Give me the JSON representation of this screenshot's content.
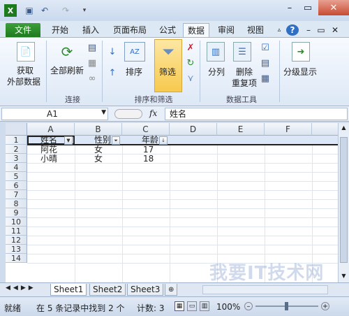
{
  "quick_access": {
    "icons": [
      "excel-icon",
      "save-icon",
      "undo-icon",
      "redo-icon"
    ]
  },
  "menu": {
    "file": "文件",
    "home": "开始",
    "insert": "插入",
    "page_layout": "页面布局",
    "formulas": "公式",
    "data": "数据",
    "review": "审阅",
    "view": "视图"
  },
  "ribbon": {
    "get_external_line1": "获取",
    "get_external_line2": "外部数据",
    "refresh_all": "全部刷新",
    "connections_group": "连接",
    "sort": "排序",
    "filter": "筛选",
    "sort_filter_group": "排序和筛选",
    "text_to_columns": "分列",
    "remove_dup_line1": "删除",
    "remove_dup_line2": "重复项",
    "data_tools_group": "数据工具",
    "outline": "分级显示"
  },
  "formula_bar": {
    "name_box": "A1",
    "fx": "fx",
    "content": "姓名"
  },
  "columns": [
    "A",
    "B",
    "C",
    "D",
    "E",
    "F"
  ],
  "rows": [
    "1",
    "2",
    "3",
    "4",
    "5",
    "6",
    "7",
    "8",
    "9",
    "10",
    "11",
    "12",
    "13",
    "14"
  ],
  "cells": {
    "a1": "姓名",
    "b1": "性别",
    "c1": "年龄",
    "a3": "阿花",
    "b3": "女",
    "c3": "17",
    "a4": "小晴",
    "b4": "女",
    "c4": "18"
  },
  "sheets": {
    "sheet1": "Sheet1",
    "sheet2": "Sheet2",
    "sheet3": "Sheet3"
  },
  "status": {
    "ready": "就绪",
    "found": "在 5 条记录中找到 2 个",
    "count": "计数: 3",
    "zoom": "100%"
  },
  "watermark": "我要IT技术网",
  "colors": {
    "accent_green": "#1e7a1e",
    "filter_highlight": "#f7c94e",
    "header_fill": "#dbe4f0"
  }
}
